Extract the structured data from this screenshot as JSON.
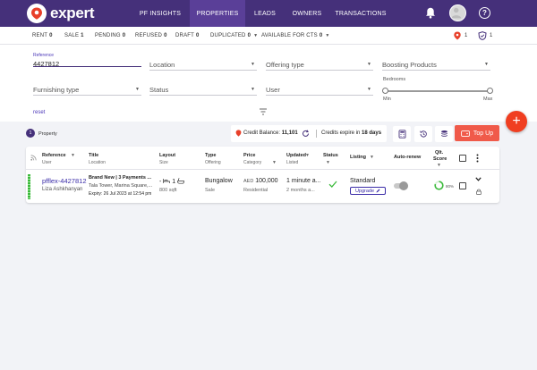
{
  "brand": {
    "name": "expert",
    "accent": "#45307a",
    "accent_active": "#5a3f98",
    "danger": "#f03e20"
  },
  "nav": {
    "items": [
      {
        "label": "PF INSIGHTS"
      },
      {
        "label": "PROPERTIES",
        "active": true
      },
      {
        "label": "LEADS"
      },
      {
        "label": "OWNERS"
      },
      {
        "label": "TRANSACTIONS"
      }
    ],
    "icons": [
      "bell-icon",
      "avatar",
      "help-icon"
    ],
    "help_glyph": "?"
  },
  "status_bar": {
    "items": [
      {
        "label": "RENT",
        "count": "0"
      },
      {
        "label": "SALE",
        "count": "1"
      },
      {
        "label": "PENDING",
        "count": "0"
      },
      {
        "label": "REFUSED",
        "count": "0"
      },
      {
        "label": "DRAFT",
        "count": "0"
      }
    ],
    "duplicated_label": "DUPLICATED",
    "duplicated_count": "0",
    "available_label": "AVAILABLE FOR CTS",
    "available_count": "0",
    "badge_fire_count": "1",
    "badge_shield_count": "1"
  },
  "filters": {
    "reference": {
      "label": "Reference",
      "value": "4427812"
    },
    "location": {
      "placeholder": "Location"
    },
    "offering_type": {
      "placeholder": "Offering type"
    },
    "boosting_products": {
      "placeholder": "Boosting Products"
    },
    "furnishing_type": {
      "placeholder": "Furnishing type"
    },
    "status": {
      "placeholder": "Status"
    },
    "user": {
      "placeholder": "User"
    },
    "bedrooms": {
      "label": "Bedrooms",
      "min_label": "Min",
      "max_label": "Max"
    },
    "reset_label": "reset"
  },
  "fab": {
    "glyph": "+"
  },
  "toolbar": {
    "property_count": "1",
    "property_label": "Property",
    "credit_balance_label": "Credit Balance:",
    "credit_balance_value": "11,101",
    "credits_expire_label": "Credits expire in",
    "credits_expire_value": "18 days",
    "top_up_label": "Top Up"
  },
  "table": {
    "columns": [
      {
        "title": "Reference",
        "sub": "User"
      },
      {
        "title": "Title",
        "sub": "Location"
      },
      {
        "title": "Layout",
        "sub": "Size"
      },
      {
        "title": "Type",
        "sub": "Offering"
      },
      {
        "title": "Price",
        "sub": "Category"
      },
      {
        "title": "Updated",
        "sub": "Listed"
      },
      {
        "title": "Status",
        "sub": ""
      },
      {
        "title": "Listing",
        "sub": ""
      },
      {
        "title": "Auto-renew",
        "sub": ""
      },
      {
        "title": "Qlt.",
        "sub": "Score"
      }
    ],
    "rows": [
      {
        "reference": "pfflex-4427812",
        "agent": "Liza Ashkhanyan",
        "title": "Brand New | 3 Payments ...",
        "location": "Tala Tower, Marina Square,...",
        "expiry": "Expiry: 26 Jul 2023 at 12:54 pm",
        "layout_dash": "-",
        "layout_baths": "1",
        "size": "800 sqft",
        "type": "Bungalow",
        "offering": "Sale",
        "price_currency": "AED",
        "price": "100,000",
        "category": "Residential",
        "updated": "1 minute a...",
        "listed": "2 months a...",
        "listing": "Standard",
        "upgrade_label": "Upgrade",
        "quality_score": "80%",
        "quality_value": 80
      }
    ]
  }
}
